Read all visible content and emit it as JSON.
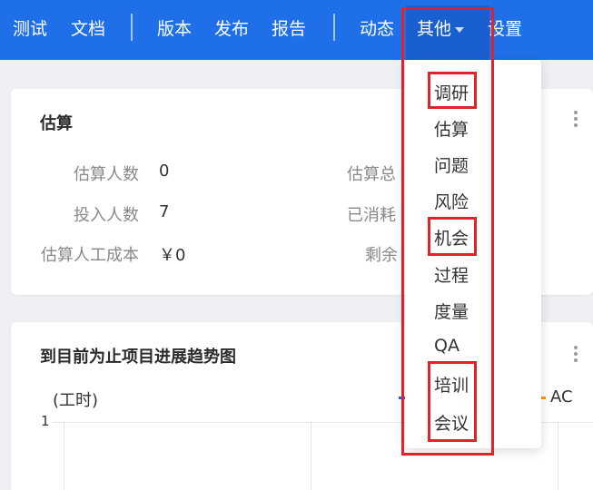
{
  "nav": {
    "items": [
      "测试",
      "文档",
      "版本",
      "发布",
      "报告",
      "动态",
      "其他",
      "设置"
    ]
  },
  "dropdown": {
    "items": [
      "调研",
      "估算",
      "问题",
      "风险",
      "机会",
      "过程",
      "度量",
      "QA",
      "培训",
      "会议"
    ]
  },
  "estimate_card": {
    "title": "估算",
    "rows": [
      {
        "label": "估算人数",
        "value": "0",
        "label2": "估算总"
      },
      {
        "label": "投入人数",
        "value": "7",
        "label2": "已消耗"
      },
      {
        "label": "估算人工成本",
        "value": "￥0",
        "label2": "剩余"
      }
    ]
  },
  "trend_card": {
    "title": "到目前为止项目进展趋势图",
    "y_unit": "(工时)",
    "y_tick": "1",
    "legend_ac": "AC"
  },
  "colors": {
    "topbar": "#1f6fe8",
    "highlight": "#e0222a",
    "legend_blue": "#2b5fd9",
    "legend_orange": "#f39a1e"
  }
}
